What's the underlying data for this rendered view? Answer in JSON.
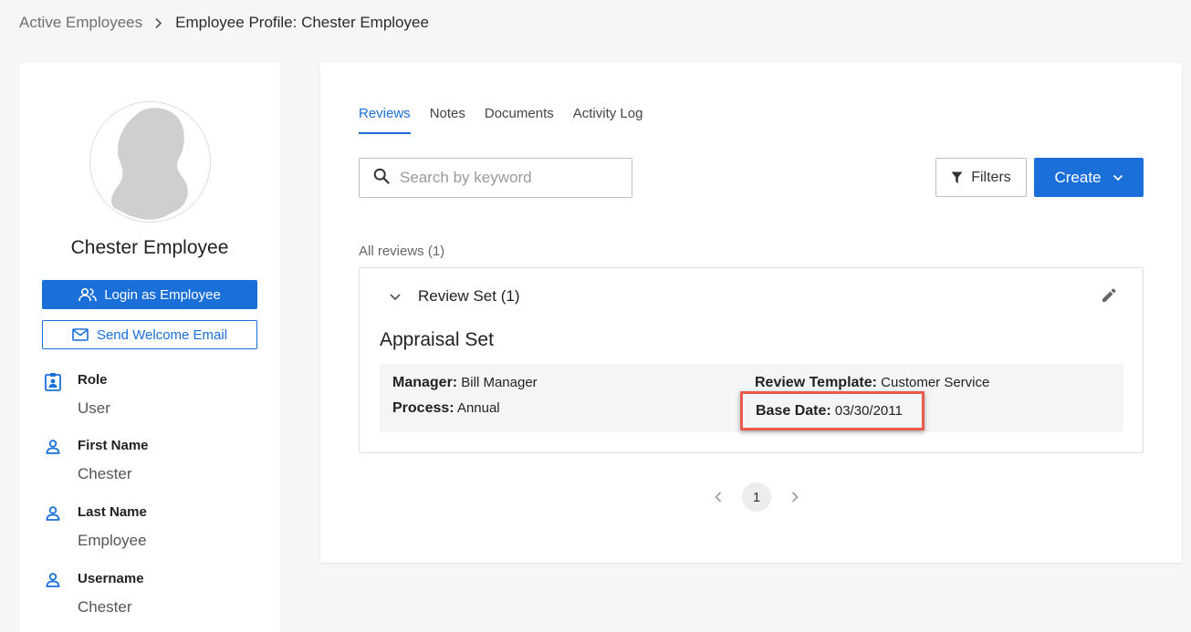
{
  "breadcrumb": {
    "parent": "Active Employees",
    "current": "Employee Profile: Chester Employee"
  },
  "profile": {
    "name": "Chester Employee",
    "login_label": "Login as Employee",
    "welcome_label": "Send Welcome Email",
    "fields": [
      {
        "label": "Role",
        "value": "User",
        "icon": "badge-icon"
      },
      {
        "label": "First Name",
        "value": "Chester",
        "icon": "person-icon"
      },
      {
        "label": "Last Name",
        "value": "Employee",
        "icon": "person-icon"
      },
      {
        "label": "Username",
        "value": "Chester",
        "icon": "person-icon"
      }
    ]
  },
  "tabs": [
    {
      "label": "Reviews",
      "active": true
    },
    {
      "label": "Notes",
      "active": false
    },
    {
      "label": "Documents",
      "active": false
    },
    {
      "label": "Activity Log",
      "active": false
    }
  ],
  "search": {
    "placeholder": "Search by keyword"
  },
  "toolbar": {
    "filters_label": "Filters",
    "create_label": "Create"
  },
  "reviews": {
    "count_label": "All reviews (1)",
    "set_title": "Review Set (1)",
    "appraisal_title": "Appraisal Set",
    "details": {
      "manager_label": "Manager:",
      "manager_value": "Bill Manager",
      "process_label": "Process:",
      "process_value": "Annual",
      "template_label": "Review Template:",
      "template_value": "Customer Service",
      "base_date_label": "Base Date:",
      "base_date_value": "03/30/2011"
    }
  },
  "pagination": {
    "current_page": "1"
  },
  "colors": {
    "primary": "#1a6fd8",
    "highlight": "#e8594e"
  }
}
